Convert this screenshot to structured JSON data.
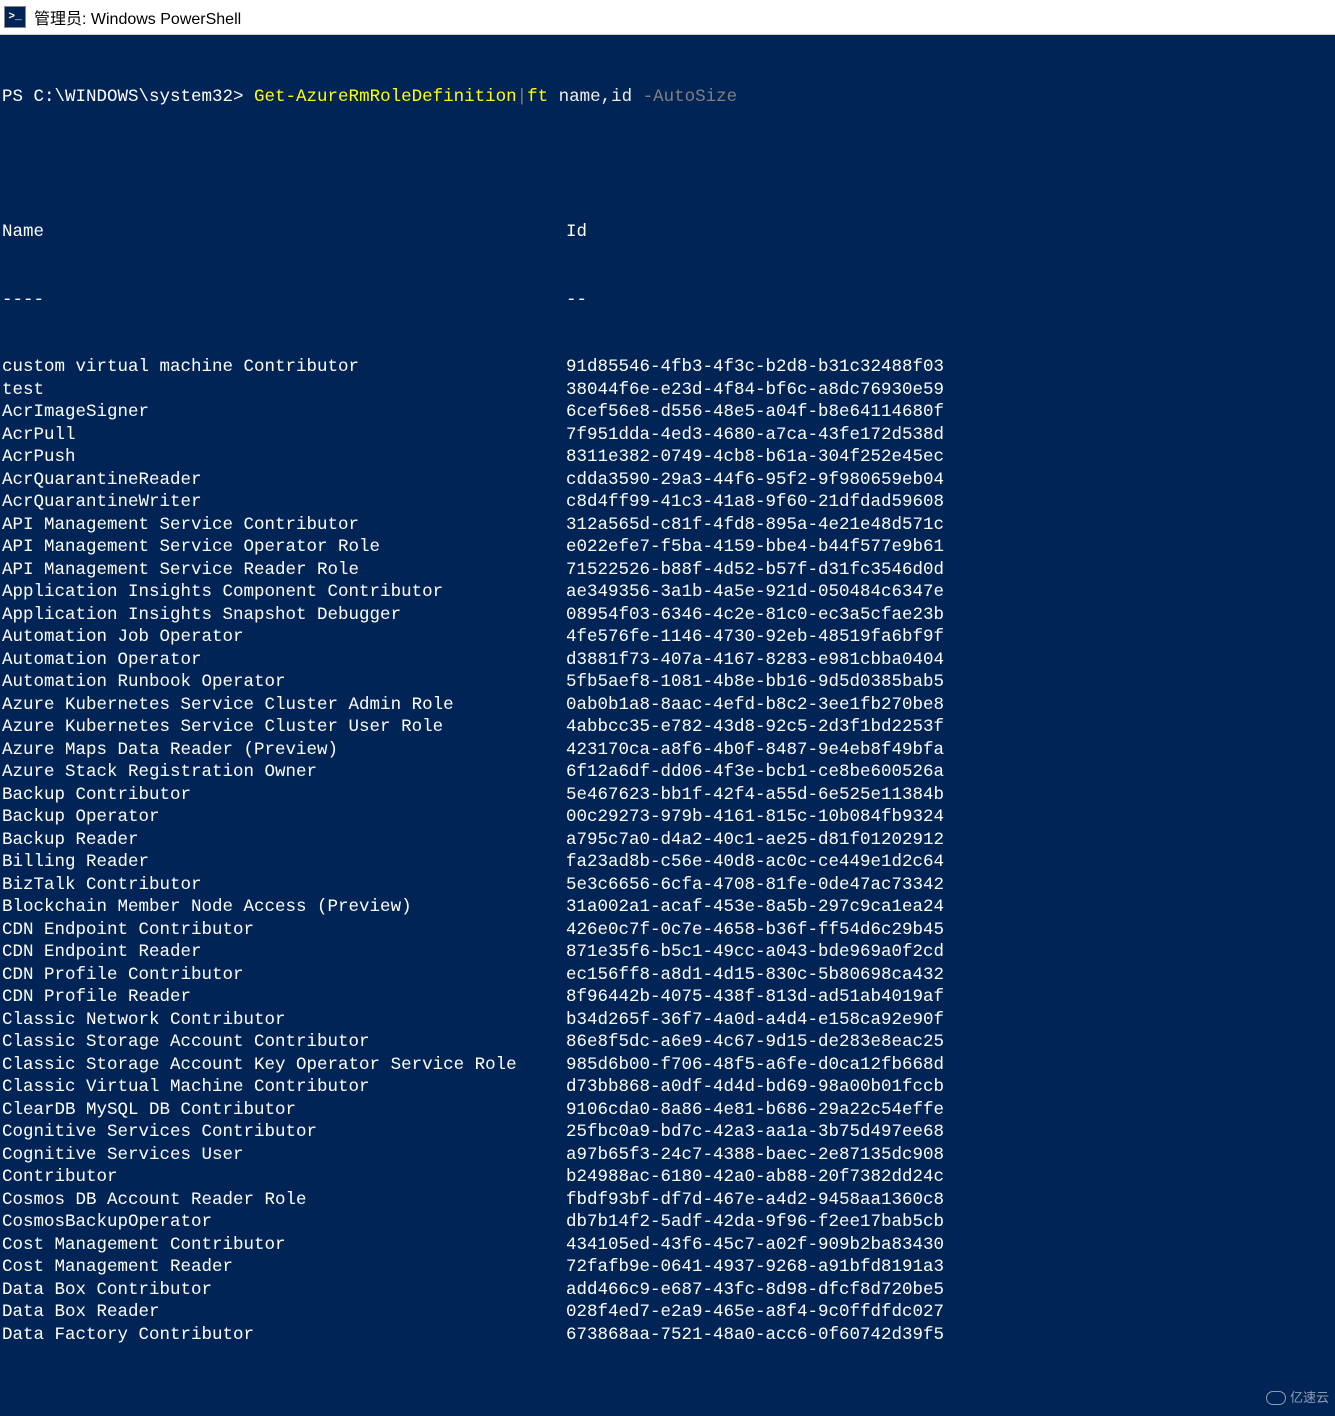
{
  "window": {
    "title": "管理员: Windows PowerShell",
    "icon_label": ">_"
  },
  "prompt": {
    "prefix": "PS C:\\WINDOWS\\system32> ",
    "cmdlet": "Get-AzureRmRoleDefinition",
    "pipe": "|",
    "ft": "ft",
    "args": " name,id ",
    "switch": "-AutoSize"
  },
  "columns": {
    "name_header": "Name",
    "id_header": "Id",
    "name_dash": "----",
    "id_dash": "--"
  },
  "rows": [
    {
      "name": "custom virtual machine Contributor",
      "id": "91d85546-4fb3-4f3c-b2d8-b31c32488f03"
    },
    {
      "name": "test",
      "id": "38044f6e-e23d-4f84-bf6c-a8dc76930e59"
    },
    {
      "name": "AcrImageSigner",
      "id": "6cef56e8-d556-48e5-a04f-b8e64114680f"
    },
    {
      "name": "AcrPull",
      "id": "7f951dda-4ed3-4680-a7ca-43fe172d538d"
    },
    {
      "name": "AcrPush",
      "id": "8311e382-0749-4cb8-b61a-304f252e45ec"
    },
    {
      "name": "AcrQuarantineReader",
      "id": "cdda3590-29a3-44f6-95f2-9f980659eb04"
    },
    {
      "name": "AcrQuarantineWriter",
      "id": "c8d4ff99-41c3-41a8-9f60-21dfdad59608"
    },
    {
      "name": "API Management Service Contributor",
      "id": "312a565d-c81f-4fd8-895a-4e21e48d571c"
    },
    {
      "name": "API Management Service Operator Role",
      "id": "e022efe7-f5ba-4159-bbe4-b44f577e9b61"
    },
    {
      "name": "API Management Service Reader Role",
      "id": "71522526-b88f-4d52-b57f-d31fc3546d0d"
    },
    {
      "name": "Application Insights Component Contributor",
      "id": "ae349356-3a1b-4a5e-921d-050484c6347e"
    },
    {
      "name": "Application Insights Snapshot Debugger",
      "id": "08954f03-6346-4c2e-81c0-ec3a5cfae23b"
    },
    {
      "name": "Automation Job Operator",
      "id": "4fe576fe-1146-4730-92eb-48519fa6bf9f"
    },
    {
      "name": "Automation Operator",
      "id": "d3881f73-407a-4167-8283-e981cbba0404"
    },
    {
      "name": "Automation Runbook Operator",
      "id": "5fb5aef8-1081-4b8e-bb16-9d5d0385bab5"
    },
    {
      "name": "Azure Kubernetes Service Cluster Admin Role",
      "id": "0ab0b1a8-8aac-4efd-b8c2-3ee1fb270be8"
    },
    {
      "name": "Azure Kubernetes Service Cluster User Role",
      "id": "4abbcc35-e782-43d8-92c5-2d3f1bd2253f"
    },
    {
      "name": "Azure Maps Data Reader (Preview)",
      "id": "423170ca-a8f6-4b0f-8487-9e4eb8f49bfa"
    },
    {
      "name": "Azure Stack Registration Owner",
      "id": "6f12a6df-dd06-4f3e-bcb1-ce8be600526a"
    },
    {
      "name": "Backup Contributor",
      "id": "5e467623-bb1f-42f4-a55d-6e525e11384b"
    },
    {
      "name": "Backup Operator",
      "id": "00c29273-979b-4161-815c-10b084fb9324"
    },
    {
      "name": "Backup Reader",
      "id": "a795c7a0-d4a2-40c1-ae25-d81f01202912"
    },
    {
      "name": "Billing Reader",
      "id": "fa23ad8b-c56e-40d8-ac0c-ce449e1d2c64"
    },
    {
      "name": "BizTalk Contributor",
      "id": "5e3c6656-6cfa-4708-81fe-0de47ac73342"
    },
    {
      "name": "Blockchain Member Node Access (Preview)",
      "id": "31a002a1-acaf-453e-8a5b-297c9ca1ea24"
    },
    {
      "name": "CDN Endpoint Contributor",
      "id": "426e0c7f-0c7e-4658-b36f-ff54d6c29b45"
    },
    {
      "name": "CDN Endpoint Reader",
      "id": "871e35f6-b5c1-49cc-a043-bde969a0f2cd"
    },
    {
      "name": "CDN Profile Contributor",
      "id": "ec156ff8-a8d1-4d15-830c-5b80698ca432"
    },
    {
      "name": "CDN Profile Reader",
      "id": "8f96442b-4075-438f-813d-ad51ab4019af"
    },
    {
      "name": "Classic Network Contributor",
      "id": "b34d265f-36f7-4a0d-a4d4-e158ca92e90f"
    },
    {
      "name": "Classic Storage Account Contributor",
      "id": "86e8f5dc-a6e9-4c67-9d15-de283e8eac25"
    },
    {
      "name": "Classic Storage Account Key Operator Service Role",
      "id": "985d6b00-f706-48f5-a6fe-d0ca12fb668d"
    },
    {
      "name": "Classic Virtual Machine Contributor",
      "id": "d73bb868-a0df-4d4d-bd69-98a00b01fccb"
    },
    {
      "name": "ClearDB MySQL DB Contributor",
      "id": "9106cda0-8a86-4e81-b686-29a22c54effe"
    },
    {
      "name": "Cognitive Services Contributor",
      "id": "25fbc0a9-bd7c-42a3-aa1a-3b75d497ee68"
    },
    {
      "name": "Cognitive Services User",
      "id": "a97b65f3-24c7-4388-baec-2e87135dc908"
    },
    {
      "name": "Contributor",
      "id": "b24988ac-6180-42a0-ab88-20f7382dd24c"
    },
    {
      "name": "Cosmos DB Account Reader Role",
      "id": "fbdf93bf-df7d-467e-a4d2-9458aa1360c8"
    },
    {
      "name": "CosmosBackupOperator",
      "id": "db7b14f2-5adf-42da-9f96-f2ee17bab5cb"
    },
    {
      "name": "Cost Management Contributor",
      "id": "434105ed-43f6-45c7-a02f-909b2ba83430"
    },
    {
      "name": "Cost Management Reader",
      "id": "72fafb9e-0641-4937-9268-a91bfd8191a3"
    },
    {
      "name": "Data Box Contributor",
      "id": "add466c9-e687-43fc-8d98-dfcf8d720be5"
    },
    {
      "name": "Data Box Reader",
      "id": "028f4ed7-e2a9-465e-a8f4-9c0ffdfdc027"
    },
    {
      "name": "Data Factory Contributor",
      "id": "673868aa-7521-48a0-acc6-0f60742d39f5"
    }
  ],
  "watermark": {
    "text": "亿速云"
  }
}
